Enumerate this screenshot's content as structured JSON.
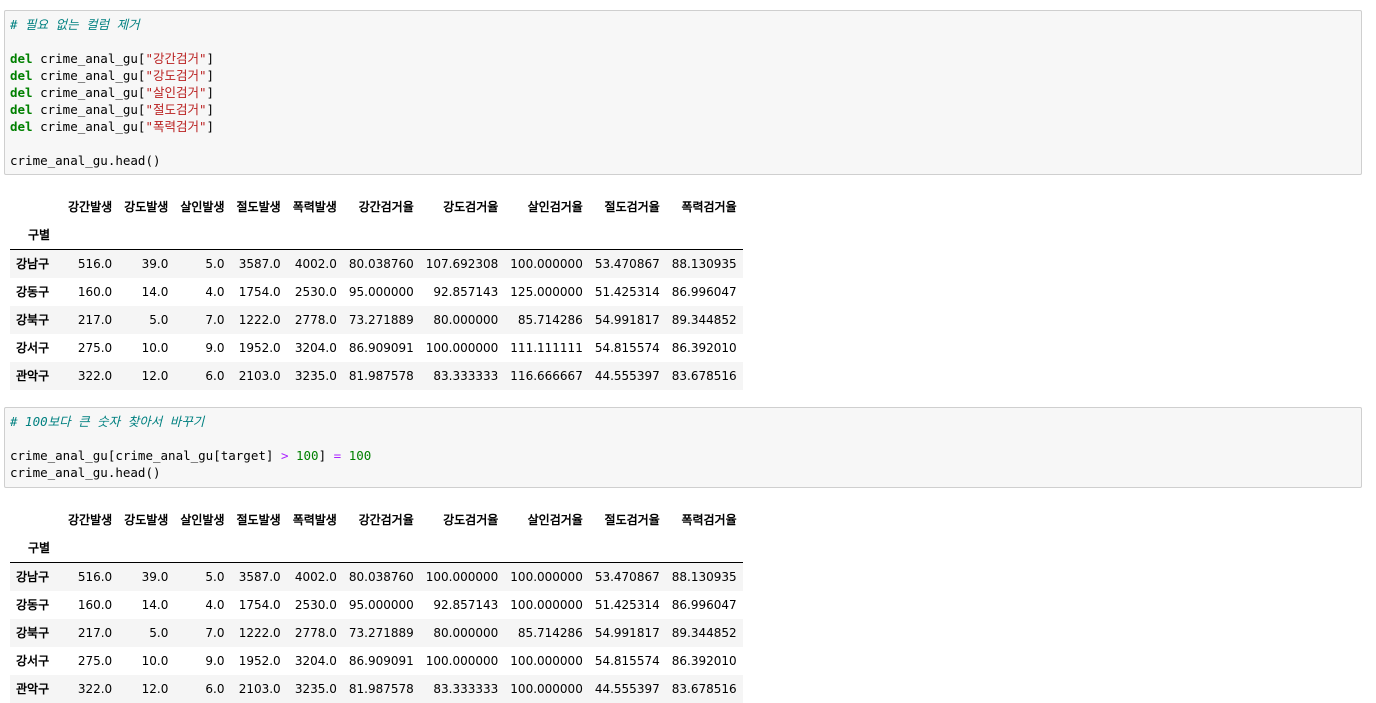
{
  "cell1": {
    "lines": [
      [
        {
          "t": "cm",
          "v": "# 필요 없는 컬럼 제거"
        }
      ],
      [],
      [
        {
          "t": "kw",
          "v": "del"
        },
        {
          "t": "",
          "v": " crime_anal_gu["
        },
        {
          "t": "st",
          "v": "\"강간검거\""
        },
        {
          "t": "",
          "v": "]"
        }
      ],
      [
        {
          "t": "kw",
          "v": "del"
        },
        {
          "t": "",
          "v": " crime_anal_gu["
        },
        {
          "t": "st",
          "v": "\"강도검거\""
        },
        {
          "t": "",
          "v": "]"
        }
      ],
      [
        {
          "t": "kw",
          "v": "del"
        },
        {
          "t": "",
          "v": " crime_anal_gu["
        },
        {
          "t": "st",
          "v": "\"살인검거\""
        },
        {
          "t": "",
          "v": "]"
        }
      ],
      [
        {
          "t": "kw",
          "v": "del"
        },
        {
          "t": "",
          "v": " crime_anal_gu["
        },
        {
          "t": "st",
          "v": "\"절도검거\""
        },
        {
          "t": "",
          "v": "]"
        }
      ],
      [
        {
          "t": "kw",
          "v": "del"
        },
        {
          "t": "",
          "v": " crime_anal_gu["
        },
        {
          "t": "st",
          "v": "\"폭력검거\""
        },
        {
          "t": "",
          "v": "]"
        }
      ],
      [],
      [
        {
          "t": "",
          "v": "crime_anal_gu.head()"
        }
      ]
    ]
  },
  "cell2": {
    "lines": [
      [
        {
          "t": "cm",
          "v": "# 100보다 큰 숫자 찾아서 바꾸기"
        }
      ],
      [],
      [
        {
          "t": "",
          "v": "crime_anal_gu[crime_anal_gu[target] "
        },
        {
          "t": "op",
          "v": ">"
        },
        {
          "t": "",
          "v": " "
        },
        {
          "t": "nu",
          "v": "100"
        },
        {
          "t": "",
          "v": "] "
        },
        {
          "t": "op",
          "v": "="
        },
        {
          "t": "",
          "v": " "
        },
        {
          "t": "nu",
          "v": "100"
        }
      ],
      [
        {
          "t": "",
          "v": "crime_anal_gu.head()"
        }
      ]
    ]
  },
  "table1": {
    "index_name": "구별",
    "columns": [
      "강간발생",
      "강도발생",
      "살인발생",
      "절도발생",
      "폭력발생",
      "강간검거율",
      "강도검거율",
      "살인검거율",
      "절도검거율",
      "폭력검거율"
    ],
    "rows": [
      {
        "index": "강남구",
        "values": [
          "516.0",
          "39.0",
          "5.0",
          "3587.0",
          "4002.0",
          "80.038760",
          "107.692308",
          "100.000000",
          "53.470867",
          "88.130935"
        ]
      },
      {
        "index": "강동구",
        "values": [
          "160.0",
          "14.0",
          "4.0",
          "1754.0",
          "2530.0",
          "95.000000",
          "92.857143",
          "125.000000",
          "51.425314",
          "86.996047"
        ]
      },
      {
        "index": "강북구",
        "values": [
          "217.0",
          "5.0",
          "7.0",
          "1222.0",
          "2778.0",
          "73.271889",
          "80.000000",
          "85.714286",
          "54.991817",
          "89.344852"
        ]
      },
      {
        "index": "강서구",
        "values": [
          "275.0",
          "10.0",
          "9.0",
          "1952.0",
          "3204.0",
          "86.909091",
          "100.000000",
          "111.111111",
          "54.815574",
          "86.392010"
        ]
      },
      {
        "index": "관악구",
        "values": [
          "322.0",
          "12.0",
          "6.0",
          "2103.0",
          "3235.0",
          "81.987578",
          "83.333333",
          "116.666667",
          "44.555397",
          "83.678516"
        ]
      }
    ]
  },
  "table2": {
    "index_name": "구별",
    "columns": [
      "강간발생",
      "강도발생",
      "살인발생",
      "절도발생",
      "폭력발생",
      "강간검거율",
      "강도검거율",
      "살인검거율",
      "절도검거율",
      "폭력검거율"
    ],
    "rows": [
      {
        "index": "강남구",
        "values": [
          "516.0",
          "39.0",
          "5.0",
          "3587.0",
          "4002.0",
          "80.038760",
          "100.000000",
          "100.000000",
          "53.470867",
          "88.130935"
        ]
      },
      {
        "index": "강동구",
        "values": [
          "160.0",
          "14.0",
          "4.0",
          "1754.0",
          "2530.0",
          "95.000000",
          "92.857143",
          "100.000000",
          "51.425314",
          "86.996047"
        ]
      },
      {
        "index": "강북구",
        "values": [
          "217.0",
          "5.0",
          "7.0",
          "1222.0",
          "2778.0",
          "73.271889",
          "80.000000",
          "85.714286",
          "54.991817",
          "89.344852"
        ]
      },
      {
        "index": "강서구",
        "values": [
          "275.0",
          "10.0",
          "9.0",
          "1952.0",
          "3204.0",
          "86.909091",
          "100.000000",
          "100.000000",
          "54.815574",
          "86.392010"
        ]
      },
      {
        "index": "관악구",
        "values": [
          "322.0",
          "12.0",
          "6.0",
          "2103.0",
          "3235.0",
          "81.987578",
          "83.333333",
          "100.000000",
          "44.555397",
          "83.678516"
        ]
      }
    ]
  }
}
